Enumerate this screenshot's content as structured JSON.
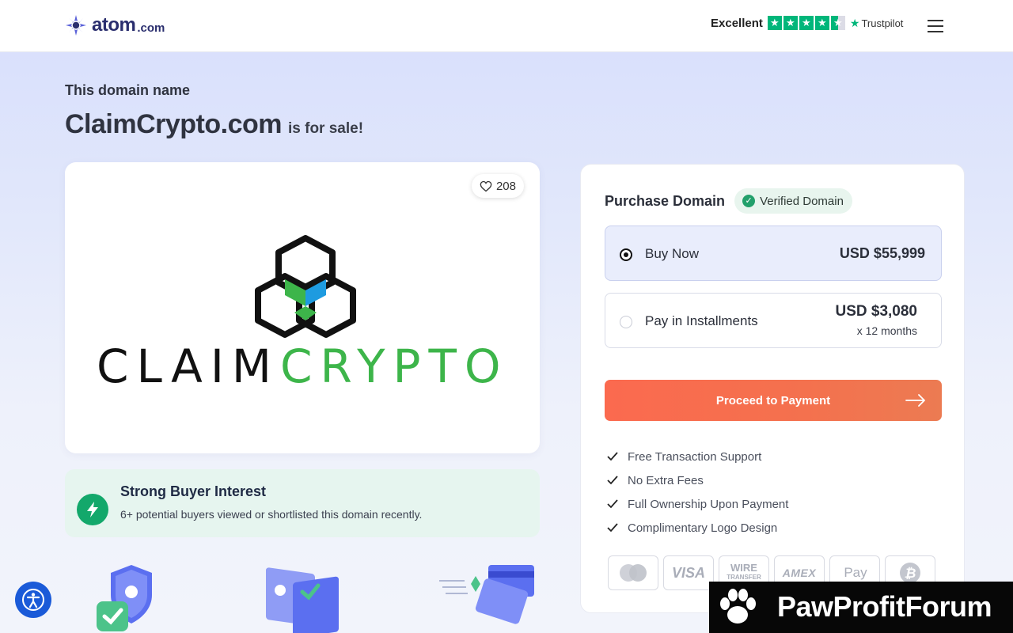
{
  "header": {
    "logo_text": "atom",
    "logo_tld": ".com",
    "trust_rating": "Excellent",
    "trust_brand": "Trustpilot",
    "stars_filled": 4.5
  },
  "hero": {
    "kicker": "This domain name",
    "domain": "ClaimCrypto.com",
    "suffix": "is for sale!"
  },
  "logo_card": {
    "likes": "208",
    "brand_left": "CLAIM",
    "brand_right": "CRYPTO"
  },
  "interest": {
    "title": "Strong Buyer Interest",
    "text": "6+ potential buyers viewed or shortlisted this domain recently."
  },
  "purchase": {
    "title": "Purchase Domain",
    "verified": "Verified Domain",
    "options": [
      {
        "label": "Buy Now",
        "price": "USD $55,999",
        "sub": "",
        "selected": true
      },
      {
        "label": "Pay in Installments",
        "price": "USD $3,080",
        "sub": "x 12 months",
        "selected": false
      }
    ],
    "cta": "Proceed to Payment",
    "benefits": [
      "Free Transaction Support",
      "No Extra Fees",
      "Full Ownership Upon Payment",
      "Complimentary Logo Design"
    ],
    "payment_methods": {
      "visa": "VISA",
      "wire_line1": "WIRE",
      "wire_line2": "TRANSFER",
      "amex": "AMEX",
      "apple": "Pay"
    }
  },
  "watermark": {
    "text": "PawProfitForum"
  },
  "colors": {
    "brand_navy": "#2a2e6e",
    "accent_orange": "#fb6a4f",
    "trust_green": "#00b67a",
    "crypto_green": "#3db54a",
    "crypto_blue": "#1e9be0"
  }
}
